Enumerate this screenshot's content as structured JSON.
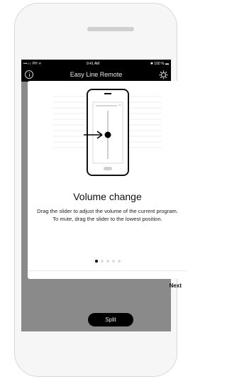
{
  "status_bar": {
    "carrier": "•••○○ PH ᯤ",
    "time": "9:41 AM",
    "battery": "✱ 100 % ▬"
  },
  "nav": {
    "title": "Easy Line Remote"
  },
  "modal": {
    "title": "Volume change",
    "body": "Drag the slider to adjust the volume of the current program. To mute, drag the slider to the lowest position.",
    "next_label": "Next",
    "page_index": 1,
    "page_count": 5
  },
  "bottom": {
    "split_label": "Split"
  },
  "icons": {
    "info": "info-icon",
    "settings": "gear-icon",
    "close": "close-icon"
  },
  "colors": {
    "nav_bg": "#000000",
    "overlay": "#8a8a8a",
    "modal_bg": "#ffffff",
    "dot_active": "#000000",
    "dot_inactive": "#dcdcdc"
  }
}
